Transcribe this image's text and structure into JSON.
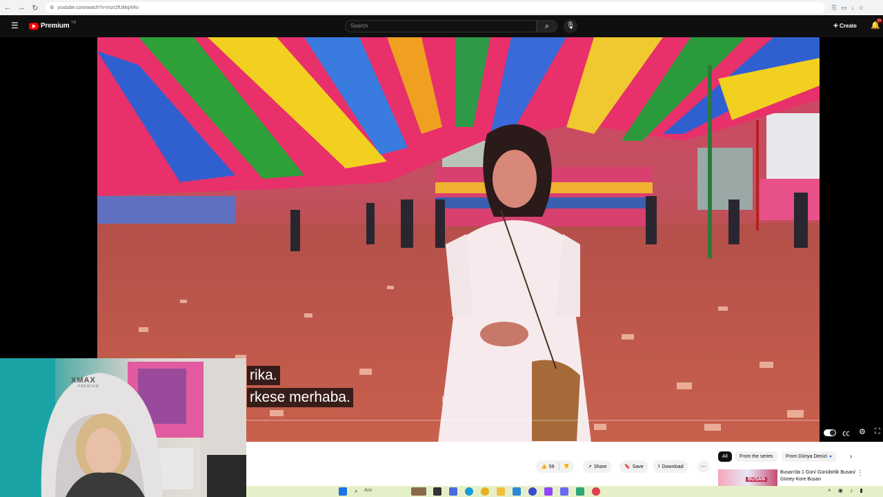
{
  "browser": {
    "url": "youtube.com/watch?v=mzr2fUMqXRo"
  },
  "header": {
    "logo_text": "Premium",
    "logo_country": "TR",
    "search_placeholder": "Search",
    "create_label": "Create",
    "notification_count": "9+"
  },
  "video": {
    "subtitle_line1": "rika.",
    "subtitle_line2": "rkese merhaba.",
    "webcam_chair_brand": "XMAX",
    "webcam_chair_sub": "PREMIUM"
  },
  "actions": {
    "like_count": "59",
    "share_label": "Share",
    "save_label": "Save",
    "download_label": "Download"
  },
  "chips": [
    {
      "label": "All",
      "active": true
    },
    {
      "label": "From the series",
      "active": false
    },
    {
      "label": "From Dünya Denizi",
      "active": false
    }
  ],
  "recommendation": {
    "title": "Busan'da 1 Gün/ Günübirlik Busan/ Güney Kore Busan",
    "thumb_text": "BUSAN"
  },
  "taskbar": {
    "search_text": "Ara"
  }
}
